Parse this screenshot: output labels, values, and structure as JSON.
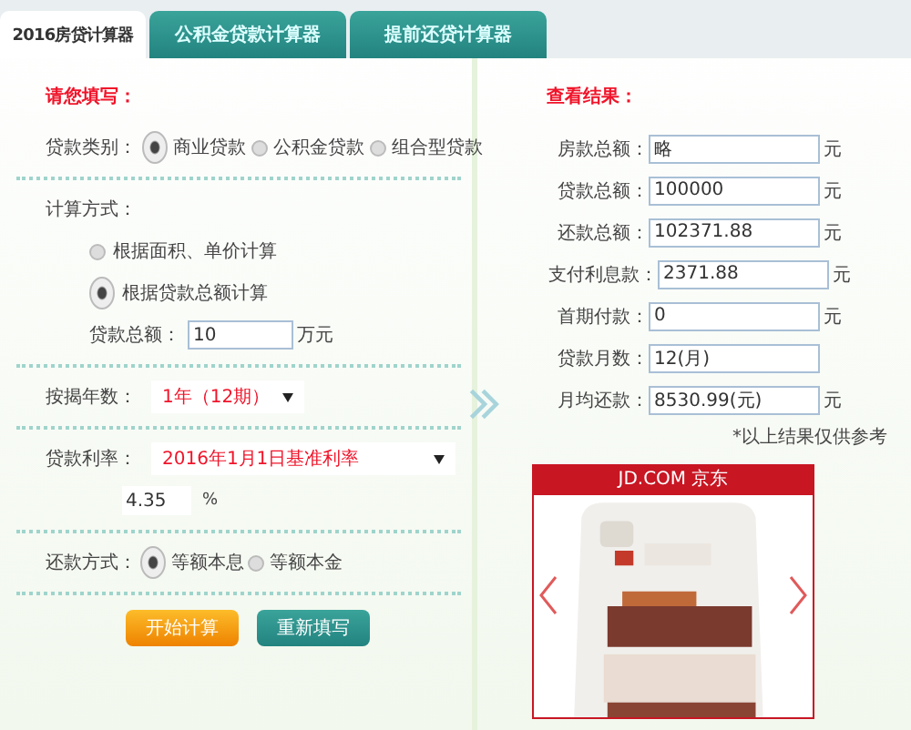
{
  "tabs": [
    {
      "label": "2016房贷计算器",
      "selected": true
    },
    {
      "label": "公积金贷款计算器",
      "selected": false
    },
    {
      "label": "提前还贷计算器",
      "selected": false
    }
  ],
  "form": {
    "heading": "请您填写：",
    "loan_type": {
      "label": "贷款类别：",
      "options": [
        {
          "label": "商业贷款",
          "selected": true
        },
        {
          "label": "公积金贷款",
          "selected": false
        },
        {
          "label": "组合型贷款",
          "selected": false
        }
      ]
    },
    "calc_method": {
      "label": "计算方式：",
      "options": [
        {
          "label": "根据面积、单价计算",
          "selected": false
        },
        {
          "label": "根据贷款总额计算",
          "selected": true
        }
      ]
    },
    "loan_amount": {
      "label": "贷款总额：",
      "value": "10",
      "unit": "万元"
    },
    "years": {
      "label": "按揭年数：",
      "value": "1年（12期）"
    },
    "rate": {
      "label": "贷款利率：",
      "value": "2016年1月1日基准利率",
      "input": "4.35",
      "unit": "%"
    },
    "repayment": {
      "label": "还款方式：",
      "options": [
        {
          "label": "等额本息",
          "selected": true
        },
        {
          "label": "等额本金",
          "selected": false
        }
      ]
    },
    "buttons": [
      {
        "label": "开始计算",
        "kind": "primary"
      },
      {
        "label": "重新填写",
        "kind": "secondary"
      }
    ]
  },
  "results": {
    "heading": "查看结果：",
    "rows": [
      {
        "label": "房款总额：",
        "value": "略",
        "unit": "元"
      },
      {
        "label": "贷款总额：",
        "value": "100000",
        "unit": "元"
      },
      {
        "label": "还款总额：",
        "value": "102371.88",
        "unit": "元"
      },
      {
        "label": "支付利息款：",
        "value": "2371.88",
        "unit": "元"
      },
      {
        "label": "首期付款：",
        "value": "0",
        "unit": "元"
      },
      {
        "label": "贷款月数：",
        "value": "12(月)"
      },
      {
        "label": "月均还款：",
        "value": "8530.99(元)",
        "unit": "元"
      }
    ],
    "note": "*以上结果仅供参考"
  },
  "ad": {
    "brand": "JD.COM 京东",
    "kind": "picture"
  }
}
